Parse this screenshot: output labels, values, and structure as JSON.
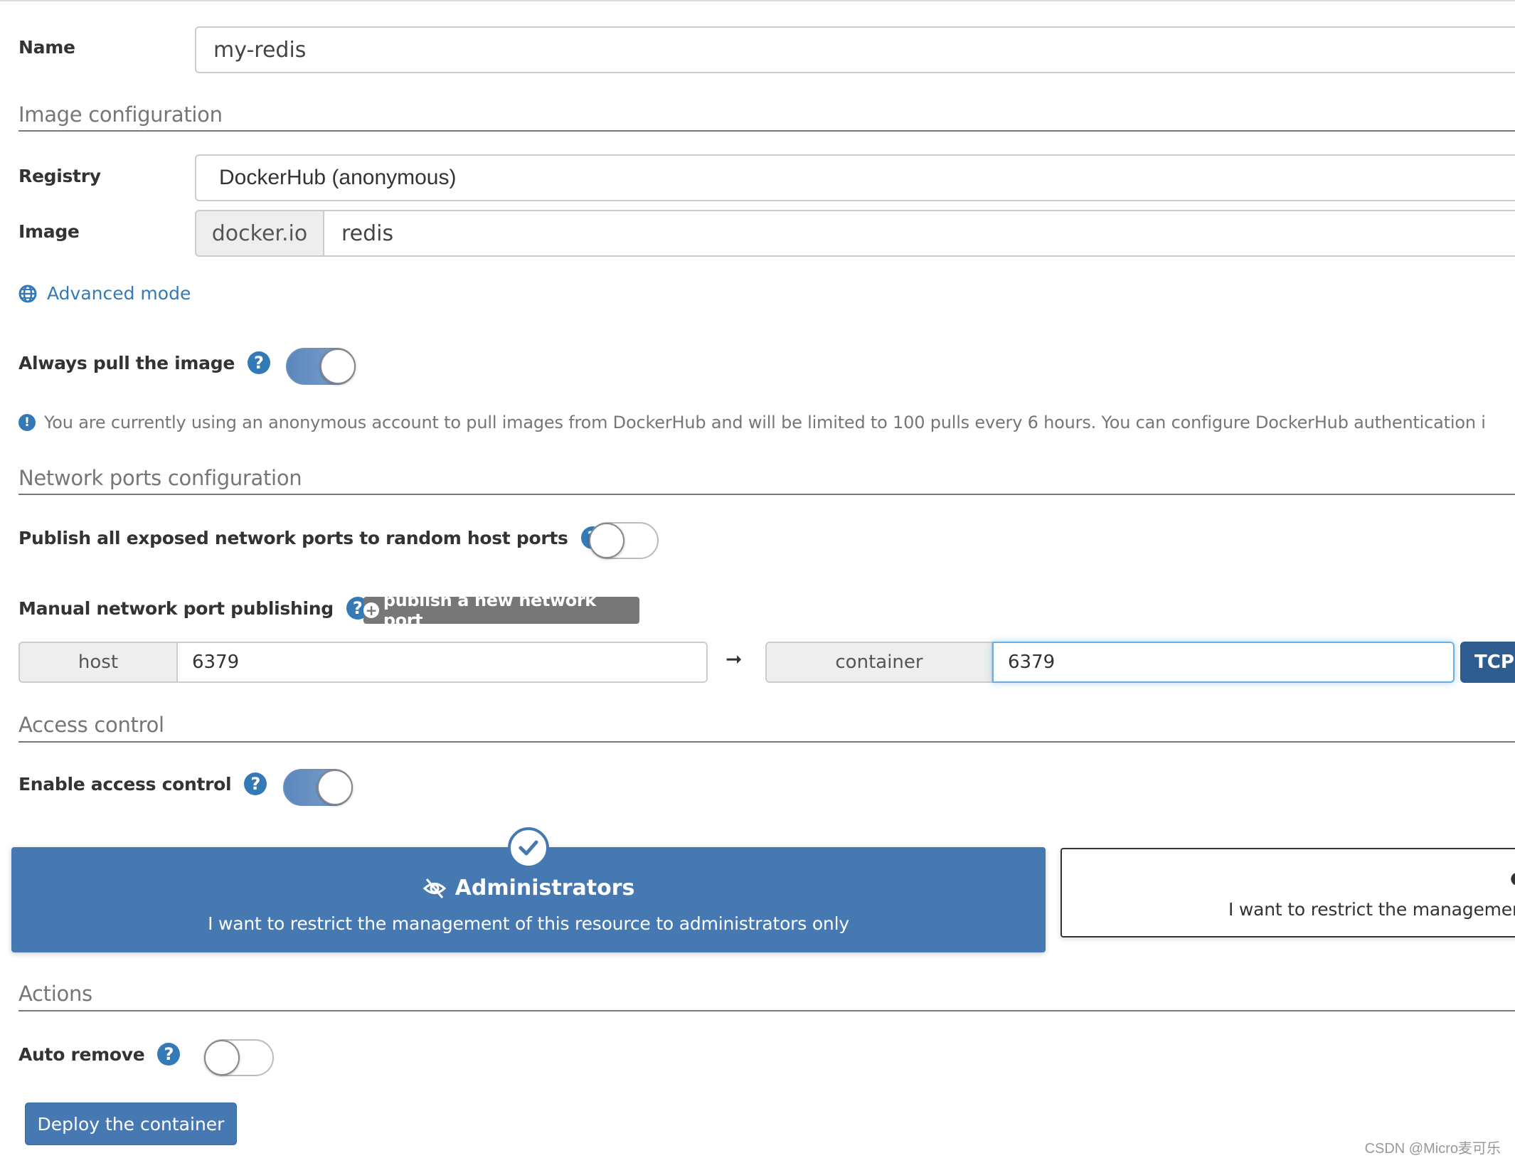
{
  "form": {
    "name": {
      "label": "Name",
      "value": "my-redis"
    },
    "image_section": {
      "title": "Image configuration",
      "registry": {
        "label": "Registry",
        "value": "DockerHub (anonymous)"
      },
      "image": {
        "label": "Image",
        "prefix": "docker.io",
        "value": "redis"
      },
      "advanced_mode_label": "Advanced mode",
      "always_pull": {
        "label": "Always pull the image",
        "help": "?",
        "enabled": true
      },
      "info_text": "You are currently using an anonymous account to pull images from DockerHub and will be limited to 100 pulls every 6 hours. You can configure DockerHub authentication i"
    },
    "network_section": {
      "title": "Network ports configuration",
      "publish_all": {
        "label": "Publish all exposed network ports to random host ports",
        "help": "?",
        "enabled": false
      },
      "manual": {
        "label": "Manual network port publishing",
        "help": "?",
        "add_button": "publish a new network port"
      },
      "port_row": {
        "host_label": "host",
        "host_value": "6379",
        "arrow": "➞",
        "container_label": "container",
        "container_value": "6379",
        "protocol": "TCP"
      }
    },
    "access_section": {
      "title": "Access control",
      "enable": {
        "label": "Enable access control",
        "help": "?",
        "enabled": true
      },
      "options": [
        {
          "title": "Administrators",
          "description": "I want to restrict the management of this resource to administrators only",
          "selected": true
        },
        {
          "title": "",
          "description": "I want to restrict the managemen",
          "selected": false
        }
      ]
    },
    "actions_section": {
      "title": "Actions",
      "auto_remove": {
        "label": "Auto remove",
        "help": "?",
        "enabled": false
      },
      "deploy_button": "Deploy the container"
    }
  },
  "watermark": "CSDN @Micro麦可乐",
  "colors": {
    "primary": "#4679b2",
    "dark_primary": "#2f5c8e",
    "grey_button": "#777777",
    "link": "#337ab7"
  }
}
